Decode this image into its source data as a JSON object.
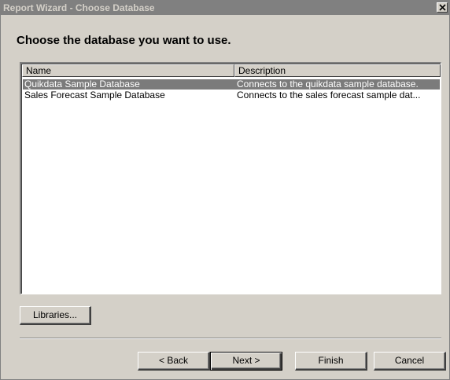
{
  "window": {
    "title": "Report Wizard - Choose Database"
  },
  "page": {
    "heading": "Choose the database you want to use."
  },
  "list": {
    "columns": [
      "Name",
      "Description"
    ],
    "rows": [
      {
        "name": "Quikdata Sample Database",
        "description": "Connects to the quikdata sample database.",
        "selected": true
      },
      {
        "name": "Sales Forecast Sample Database",
        "description": "Connects to the sales forecast sample dat...",
        "selected": false
      }
    ]
  },
  "buttons": {
    "libraries": "Libraries...",
    "back": "< Back",
    "next": "Next >",
    "finish": "Finish",
    "cancel": "Cancel"
  }
}
